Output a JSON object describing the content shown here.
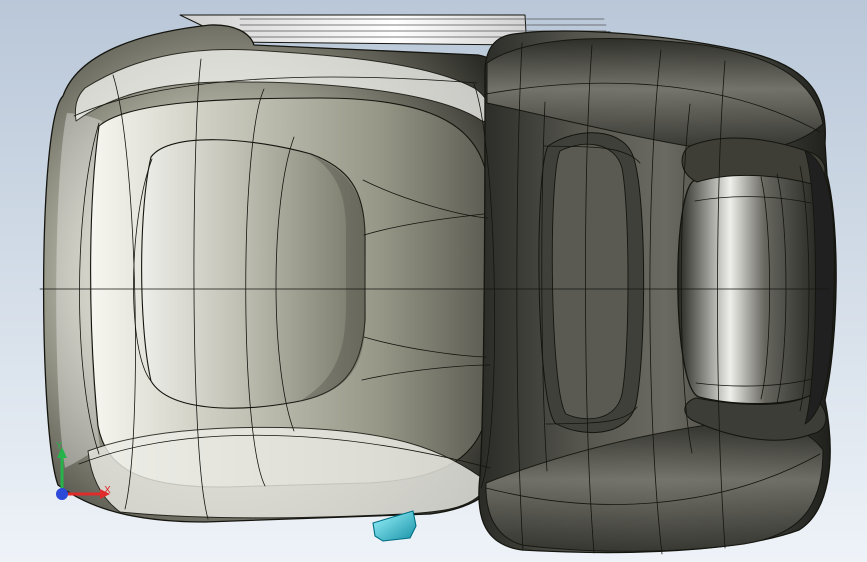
{
  "viewport": {
    "background_top": "#b9c7d8",
    "background_bottom": "#eef3f8"
  },
  "model": {
    "shell_color": "#5a5a52",
    "shell_dark": "#2d2d29",
    "shell_light": "#f4f4ef",
    "edge_color": "#15150f",
    "bracket_color": "#4fd0dd"
  },
  "triad": {
    "x_label": "X",
    "y_label": "Y",
    "x_color": "#e02b2b",
    "y_color": "#25b34a",
    "z_color": "#2c49d8"
  }
}
